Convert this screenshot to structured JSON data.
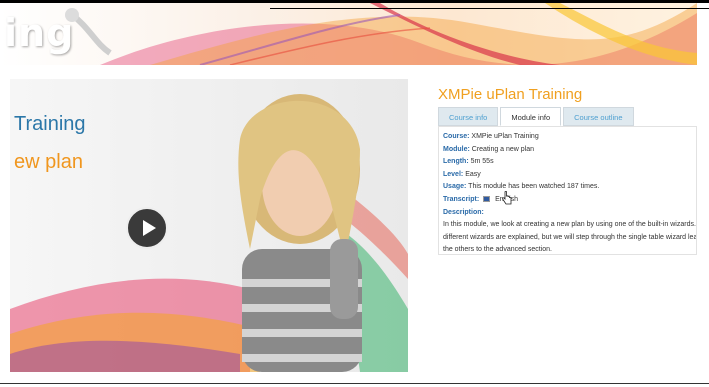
{
  "banner": {
    "title": "ing"
  },
  "video": {
    "line1": "Training",
    "line2": "ew plan",
    "play_icon": "play-icon"
  },
  "course_title": "XMPie uPlan Training",
  "tabs": [
    {
      "label": "Course info",
      "active": false
    },
    {
      "label": "Module info",
      "active": true
    },
    {
      "label": "Course outline",
      "active": false
    }
  ],
  "module_info": {
    "course_label": "Course:",
    "course_value": "XMPie uPlan Training",
    "module_label": "Module:",
    "module_value": "Creating a new plan",
    "length_label": "Length:",
    "length_value": "5m 55s",
    "level_label": "Level:",
    "level_value": "Easy",
    "usage_label": "Usage:",
    "usage_value": "This module has been watched 187 times.",
    "transcript_label": "Transcript:",
    "transcript_value": "English",
    "description_label": "Description:",
    "description_value": "In this module, we look at creating a new plan by using one of the built-in wizards. The different wizards are explained, but we will step through the single table wizard leaving the others to the advanced section."
  },
  "colors": {
    "accent": "#f0a020",
    "label_blue": "#2a6aa8",
    "tab_link": "#4fa0d0"
  }
}
